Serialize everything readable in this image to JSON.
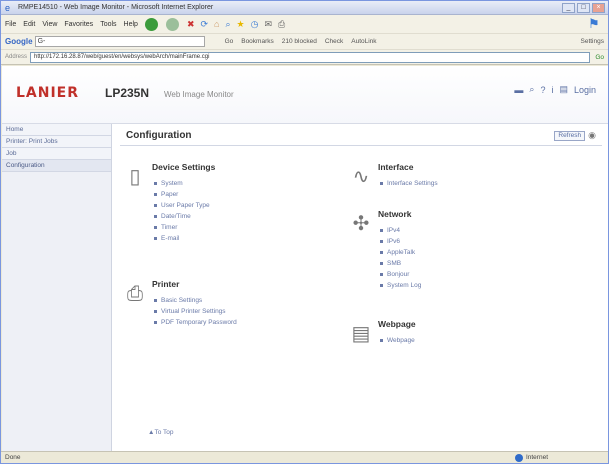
{
  "window": {
    "title": "RMPE14510 - Web Image Monitor - Microsoft Internet Explorer",
    "controls": [
      "_",
      "□",
      "×"
    ]
  },
  "menubar": {
    "items": [
      "File",
      "Edit",
      "View",
      "Favorites",
      "Tools",
      "Help"
    ]
  },
  "google_toolbar": {
    "logo": "Google",
    "search_value": "G-",
    "items": [
      "Go",
      "Bookmarks",
      "210 blocked",
      "Check",
      "AutoLink"
    ],
    "settings": "Settings"
  },
  "address": {
    "label": "Address",
    "url": "http://172.16.28.87/web/guest/en/websys/webArch/mainFrame.cgi",
    "go": "Go"
  },
  "header": {
    "logo": "LANIER",
    "model": "LP235N",
    "product": "Web Image Monitor",
    "login": "Login"
  },
  "sidebar": {
    "items": [
      {
        "label": "Home"
      },
      {
        "label": "Printer: Print Jobs"
      },
      {
        "label": "Job"
      },
      {
        "label": "Configuration"
      }
    ]
  },
  "content": {
    "title": "Configuration",
    "refresh": "Refresh"
  },
  "sections": {
    "device_settings": {
      "title": "Device Settings",
      "links": [
        "System",
        "Paper",
        "User Paper Type",
        "Date/Time",
        "Timer",
        "E-mail"
      ]
    },
    "printer": {
      "title": "Printer",
      "links": [
        "Basic Settings",
        "Virtual Printer Settings",
        "PDF Temporary Password"
      ]
    },
    "interface": {
      "title": "Interface",
      "links": [
        "Interface Settings"
      ]
    },
    "network": {
      "title": "Network",
      "links": [
        "IPv4",
        "IPv6",
        "AppleTalk",
        "SMB",
        "Bonjour",
        "System Log"
      ]
    },
    "webpage": {
      "title": "Webpage",
      "links": [
        "Webpage"
      ]
    }
  },
  "to_top": "To Top",
  "status": {
    "left": "Done",
    "zone": "Internet"
  }
}
